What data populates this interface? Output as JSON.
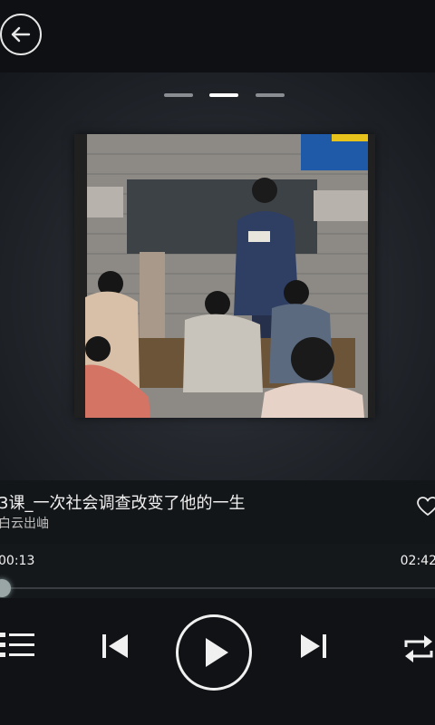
{
  "now_playing": {
    "title": "3课_一次社会调查改变了他的一生",
    "artist": "白云出岫"
  },
  "pager": {
    "pages": 3,
    "active_page": 2
  },
  "progress": {
    "current_time": "00:13",
    "total_time": "02:42",
    "fraction": 0.08
  },
  "icons": {
    "back": "arrow-left-icon",
    "favorite": "heart-outline-icon",
    "playlist": "list-icon",
    "previous": "skip-previous-icon",
    "play": "play-icon",
    "next": "skip-next-icon",
    "repeat": "repeat-icon"
  },
  "colors": {
    "background": "#111417",
    "accent": "#ffffff",
    "thumb": "#9aa6a6"
  }
}
